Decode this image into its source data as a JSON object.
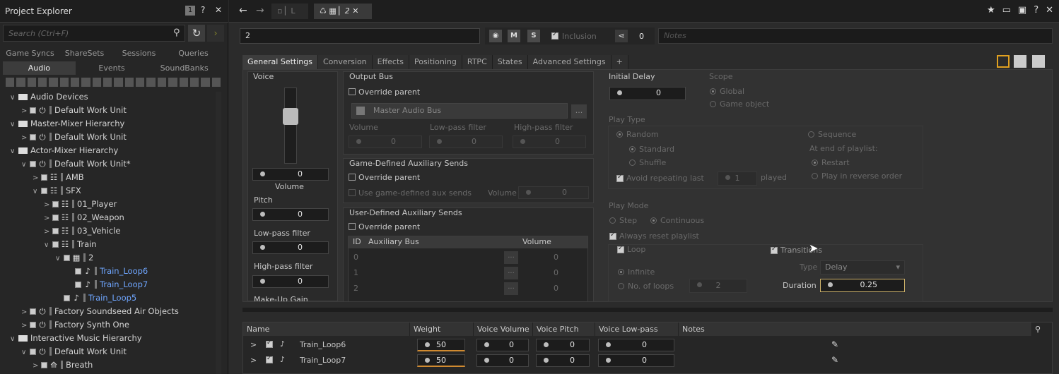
{
  "left": {
    "title": "Project Explorer",
    "badge": "1",
    "help": "?",
    "close": "✕",
    "search_placeholder": "Search (Ctrl+F)",
    "tabs1": [
      "Game Syncs",
      "ShareSets",
      "Sessions",
      "Queries"
    ],
    "tabs2": [
      "Audio",
      "Events",
      "SoundBanks"
    ],
    "tree": [
      {
        "d": 0,
        "exp": "∨",
        "type": "folder",
        "label": "Audio Devices"
      },
      {
        "d": 1,
        "exp": ">",
        "type": "wu",
        "label": "Default Work Unit"
      },
      {
        "d": 0,
        "exp": "∨",
        "type": "folder",
        "label": "Master-Mixer Hierarchy"
      },
      {
        "d": 1,
        "exp": ">",
        "type": "wu",
        "label": "Default Work Unit"
      },
      {
        "d": 0,
        "exp": "∨",
        "type": "folder",
        "label": "Actor-Mixer Hierarchy"
      },
      {
        "d": 1,
        "exp": "∨",
        "type": "wu",
        "label": "Default Work Unit*"
      },
      {
        "d": 2,
        "exp": ">",
        "type": "am",
        "label": "AMB"
      },
      {
        "d": 2,
        "exp": "∨",
        "type": "am",
        "label": "SFX"
      },
      {
        "d": 3,
        "exp": ">",
        "type": "am",
        "label": "01_Player"
      },
      {
        "d": 3,
        "exp": ">",
        "type": "am",
        "label": "02_Weapon"
      },
      {
        "d": 3,
        "exp": ">",
        "type": "am",
        "label": "03_Vehicle"
      },
      {
        "d": 3,
        "exp": "∨",
        "type": "am",
        "label": "Train"
      },
      {
        "d": 4,
        "exp": "∨",
        "type": "rc",
        "label": "2"
      },
      {
        "d": 5,
        "exp": "",
        "type": "snd",
        "label": "Train_Loop6",
        "blue": true
      },
      {
        "d": 5,
        "exp": "",
        "type": "snd",
        "label": "Train_Loop7",
        "blue": true
      },
      {
        "d": 4,
        "exp": "",
        "type": "snd",
        "label": "Train_Loop5",
        "blue": true
      },
      {
        "d": 1,
        "exp": ">",
        "type": "wu",
        "label": "Factory Soundseed Air Objects"
      },
      {
        "d": 1,
        "exp": ">",
        "type": "wu",
        "label": "Factory Synth One"
      },
      {
        "d": 0,
        "exp": "∨",
        "type": "folder",
        "label": "Interactive Music Hierarchy"
      },
      {
        "d": 1,
        "exp": "∨",
        "type": "wu",
        "label": "Default Work Unit"
      },
      {
        "d": 2,
        "exp": ">",
        "type": "mus",
        "label": "Breath"
      }
    ]
  },
  "top": {
    "nav_back": "←",
    "nav_fwd": "→",
    "tab1_label": "L",
    "tab2_label": "2",
    "tab2_close": "✕",
    "right_icons": [
      "★",
      "▭",
      "▣",
      "?",
      "✕"
    ]
  },
  "obj": {
    "name": "2",
    "m": "M",
    "s": "S",
    "inclusion": "Inclusion",
    "share_count": "0",
    "notes_placeholder": "Notes"
  },
  "tabs": [
    "General Settings",
    "Conversion",
    "Effects",
    "Positioning",
    "RTPC",
    "States",
    "Advanced Settings",
    "+"
  ],
  "voice": {
    "title": "Voice",
    "volume_value": "0",
    "volume_label": "Volume",
    "pitch_label": "Pitch",
    "pitch_value": "0",
    "lpf_label": "Low-pass filter",
    "lpf_value": "0",
    "hpf_label": "High-pass filter",
    "hpf_value": "0",
    "makeup": "Make-Up Gain"
  },
  "output_bus": {
    "title": "Output Bus",
    "override": "Override parent",
    "bus": "Master Audio Bus",
    "browse": "...",
    "vol_label": "Volume",
    "lpf_label": "Low-pass filter",
    "hpf_label": "High-pass filter",
    "vol": "0",
    "lpf": "0",
    "hpf": "0"
  },
  "gdas": {
    "title": "Game-Defined Auxiliary Sends",
    "override": "Override parent",
    "use": "Use game-defined aux sends",
    "vol_label": "Volume",
    "vol": "0"
  },
  "udas": {
    "title": "User-Defined Auxiliary Sends",
    "override": "Override parent",
    "col_id": "ID",
    "col_bus": "Auxiliary Bus",
    "col_vol": "Volume",
    "rows": [
      {
        "id": "0",
        "vol": "0"
      },
      {
        "id": "1",
        "vol": "0"
      },
      {
        "id": "2",
        "vol": "0"
      }
    ]
  },
  "delay": {
    "title": "Initial Delay",
    "value": "0",
    "scope": "Scope",
    "global": "Global",
    "gameobj": "Game object"
  },
  "play_type": {
    "title": "Play Type",
    "random": "Random",
    "standard": "Standard",
    "shuffle": "Shuffle",
    "avoid": "Avoid repeating last",
    "avoid_n": "1",
    "played": "played",
    "sequence": "Sequence",
    "end": "At end of playlist:",
    "restart": "Restart",
    "reverse": "Play in reverse order"
  },
  "play_mode": {
    "title": "Play Mode",
    "step": "Step",
    "continuous": "Continuous",
    "always_reset": "Always reset playlist",
    "loop": "Loop",
    "infinite": "Infinite",
    "no_loops": "No. of loops",
    "loops_n": "2",
    "transitions": "Transitions",
    "type_label": "Type",
    "type_value": "Delay",
    "duration_label": "Duration",
    "duration_value": "0.25"
  },
  "table": {
    "cols": [
      "Name",
      "Weight",
      "Voice Volume",
      "Voice Pitch",
      "Voice Low-pass Filter",
      "Notes"
    ],
    "rows": [
      {
        "name": "Train_Loop6",
        "weight": "50",
        "vv": "0",
        "vp": "0",
        "lpf": "0"
      },
      {
        "name": "Train_Loop7",
        "weight": "50",
        "vv": "0",
        "vp": "0",
        "lpf": "0"
      }
    ]
  },
  "icons": {
    "search": "search-icon",
    "sync": "sync-icon",
    "arrow": "arrow-right-icon",
    "palette": "palette-icon",
    "share": "share-icon",
    "pencil": "pencil-icon"
  }
}
